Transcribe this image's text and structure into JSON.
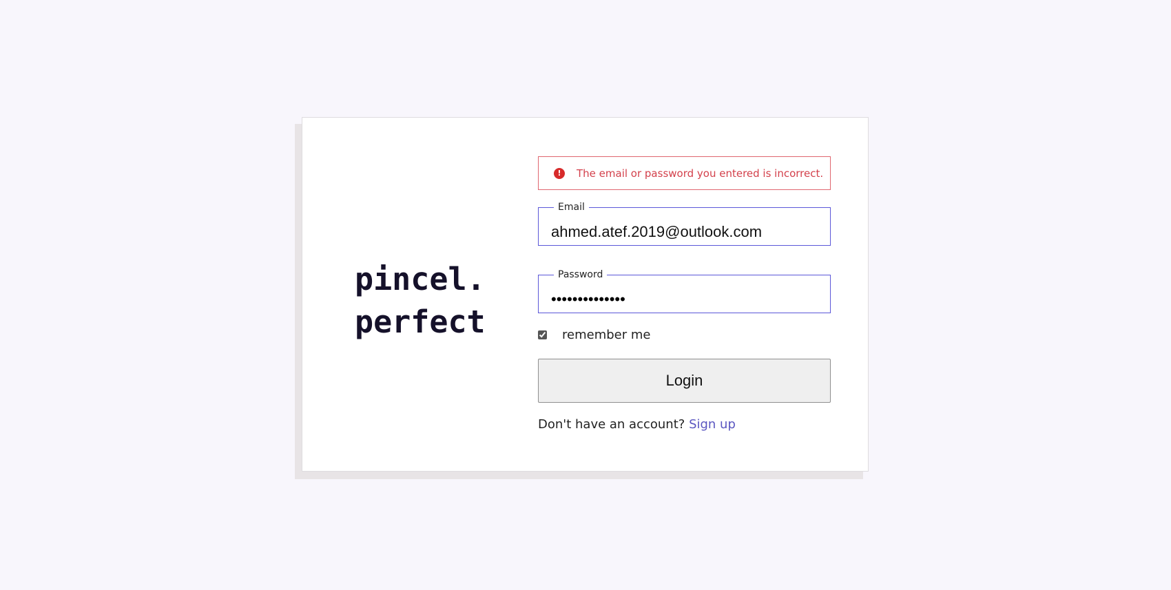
{
  "brand": {
    "logo_line1": "pincel.",
    "logo_line2": "perfect"
  },
  "alert": {
    "icon": "error-icon",
    "icon_glyph": "!",
    "message": "The email or password you entered is incorrect.",
    "border_color": "#e0656e",
    "text_color": "#d3404b"
  },
  "form": {
    "email": {
      "label": "Email",
      "value": "ahmed.atef.2019@outlook.com"
    },
    "password": {
      "label": "Password",
      "value": "••••••••••••••"
    },
    "remember": {
      "label": "remember me",
      "checked": true
    },
    "login_label": "Login",
    "accent_color": "#5a56d8"
  },
  "signup": {
    "prompt": "Don't have an account?",
    "link_label": "Sign up"
  }
}
